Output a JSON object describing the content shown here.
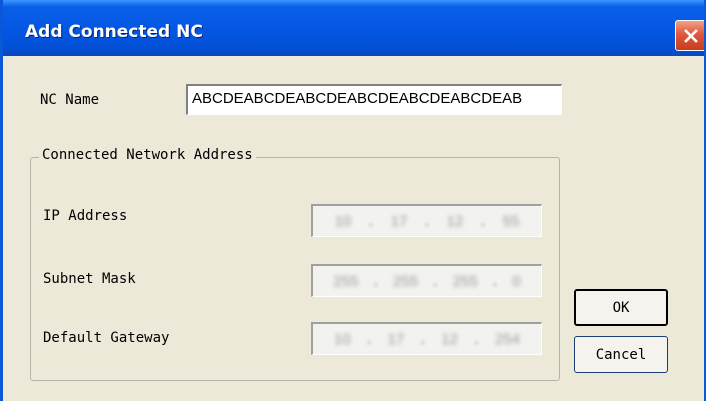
{
  "window": {
    "title": "Add Connected NC",
    "close_icon": "close-icon"
  },
  "form": {
    "nc_name_label": "NC Name",
    "nc_name_value": "ABCDEABCDEABCDEABCDEABCDEABCDEAB"
  },
  "group": {
    "legend": "Connected Network Address",
    "ip_label": "IP Address",
    "ip_octets": [
      "10",
      "17",
      "12",
      "55"
    ],
    "subnet_label": "Subnet Mask",
    "subnet_octets": [
      "255",
      "255",
      "255",
      "0"
    ],
    "gateway_label": "Default Gateway",
    "gateway_octets": [
      "10",
      "17",
      "12",
      "254"
    ]
  },
  "buttons": {
    "ok": "OK",
    "cancel": "Cancel"
  },
  "colors": {
    "titlebar": "#0456e2",
    "dialog_bg": "#ece9d8",
    "close_button": "#e0593a"
  }
}
